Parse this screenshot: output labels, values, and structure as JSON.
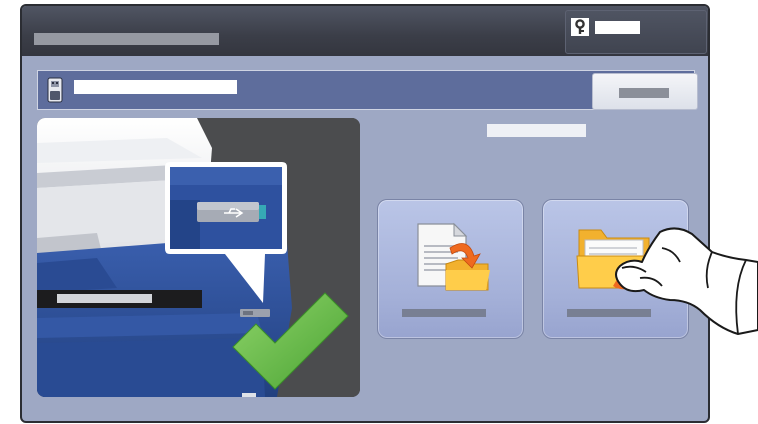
{
  "header": {
    "title": "",
    "login_label": ""
  },
  "usb_bar": {
    "label": "",
    "close_label": ""
  },
  "main": {
    "section_label": "",
    "buttons": [
      {
        "label": "",
        "icon": "scan-to-usb-icon"
      },
      {
        "label": "",
        "icon": "print-from-usb-icon"
      }
    ]
  },
  "colors": {
    "titlebar": "#3b3e48",
    "screen_bg": "#9ea8c4",
    "usb_bar": "#5e6d9c",
    "button_bg": "#afbbe2",
    "checkmark": "#6cc04a",
    "device_blue": "#2d4f99"
  }
}
